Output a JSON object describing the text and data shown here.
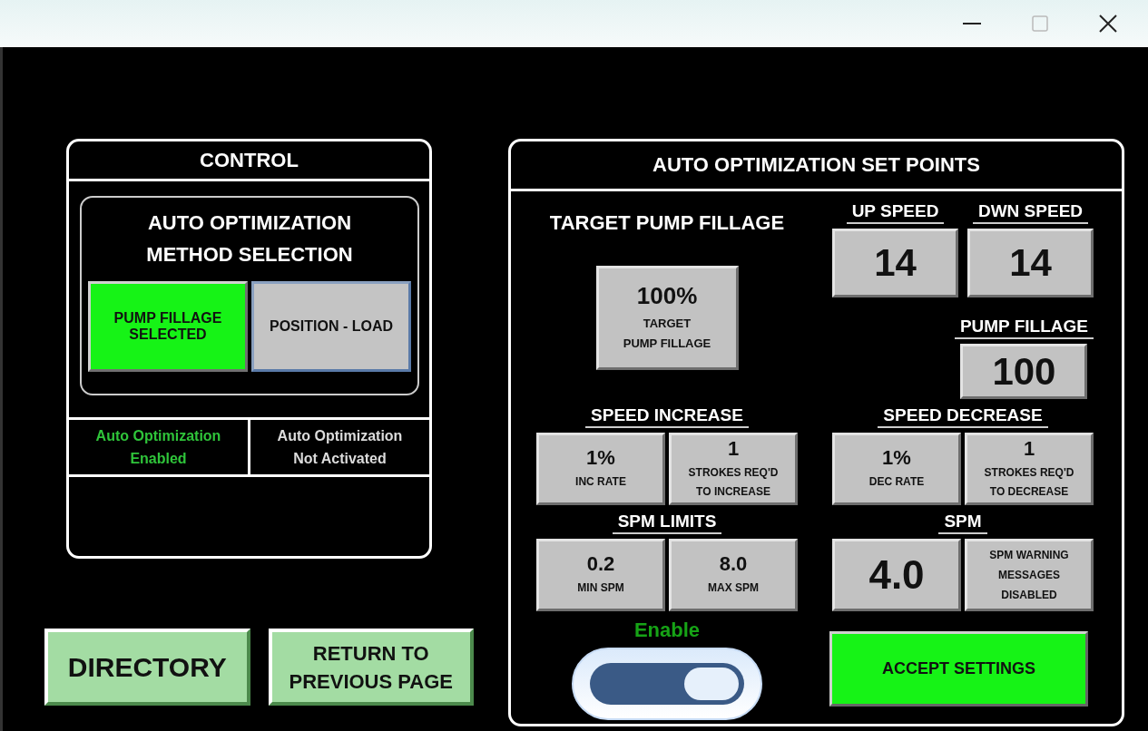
{
  "control": {
    "title": "CONTROL",
    "method_title": "AUTO OPTIMIZATION\nMETHOD SELECTION",
    "methods": [
      {
        "label": "PUMP FILLAGE\nSELECTED",
        "selected": true
      },
      {
        "label": "POSITION - LOAD",
        "selected": false
      }
    ],
    "status": [
      {
        "text": "Auto Optimization\nEnabled",
        "color": "#2fc43a"
      },
      {
        "text": "Auto Optimization\nNot Activated",
        "color": "#dcdcdc"
      }
    ]
  },
  "nav_buttons": [
    "DIRECTORY",
    "RETURN TO\nPREVIOUS PAGE"
  ],
  "setpoints": {
    "title": "AUTO OPTIMIZATION SET POINTS",
    "target": {
      "title": "TARGET PUMP FILLAGE",
      "value": "100%",
      "label": "TARGET\nPUMP FILLAGE"
    },
    "speeds": [
      {
        "title": "UP SPEED",
        "value": "14"
      },
      {
        "title": "DWN SPEED",
        "value": "14"
      }
    ],
    "pump_fillage": {
      "title": "PUMP FILLAGE",
      "value": "100"
    },
    "groups": [
      {
        "title": "SPEED INCREASE",
        "tiles": [
          {
            "kind": "rate",
            "value": "1%",
            "label": "INC RATE"
          },
          {
            "kind": "rate",
            "value": "1",
            "label": "STROKES REQ'D\nTO INCREASE"
          }
        ]
      },
      {
        "title": "SPEED DECREASE",
        "tiles": [
          {
            "kind": "rate",
            "value": "1%",
            "label": "DEC RATE"
          },
          {
            "kind": "rate",
            "value": "1",
            "label": "STROKES REQ'D\nTO DECREASE"
          }
        ]
      },
      {
        "title": "SPM LIMITS",
        "tiles": [
          {
            "kind": "rate",
            "value": "0.2",
            "label": "MIN SPM"
          },
          {
            "kind": "rate",
            "value": "8.0",
            "label": "MAX SPM"
          }
        ]
      },
      {
        "title": "SPM",
        "tiles": [
          {
            "kind": "big",
            "value": "4.0"
          },
          {
            "kind": "note",
            "label": "SPM WARNING\nMESSAGES\nDISABLED"
          }
        ]
      }
    ],
    "enable": {
      "label": "Enable",
      "on": true
    },
    "accept_button": "ACCEPT SETTINGS"
  }
}
